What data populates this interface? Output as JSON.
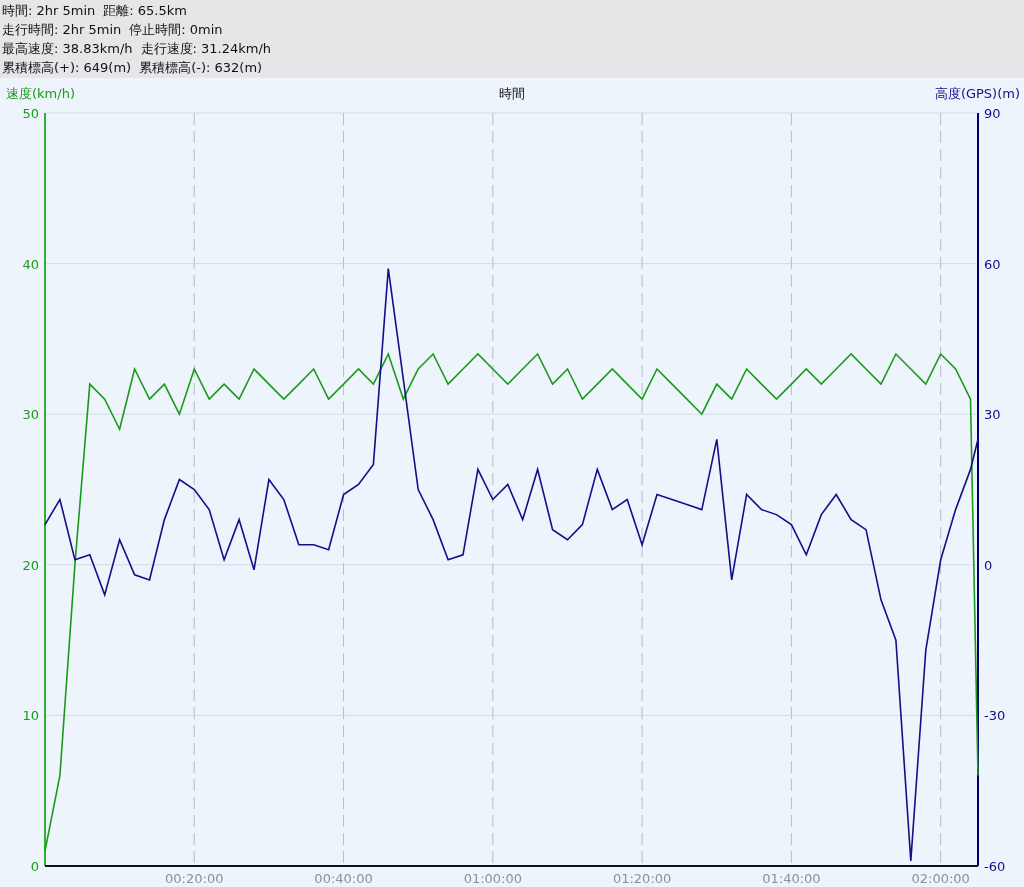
{
  "stats": [
    [
      "時間: 2hr 5min",
      "距離: 65.5km"
    ],
    [
      "走行時間: 2hr 5min",
      "停止時間: 0min"
    ],
    [
      "最高速度: 38.83km/h",
      "走行速度: 31.24km/h"
    ],
    [
      "累積標高(+): 649(m)",
      "累積標高(-): 632(m)"
    ]
  ],
  "chart_data": {
    "type": "line",
    "xlabel": "時間",
    "x": [
      0,
      2,
      4,
      6,
      8,
      10,
      12,
      14,
      16,
      18,
      20,
      22,
      24,
      26,
      28,
      30,
      32,
      34,
      36,
      38,
      40,
      42,
      44,
      46,
      48,
      50,
      52,
      54,
      56,
      58,
      60,
      62,
      64,
      66,
      68,
      70,
      72,
      74,
      76,
      78,
      80,
      82,
      84,
      86,
      88,
      90,
      92,
      94,
      96,
      98,
      100,
      102,
      104,
      106,
      108,
      110,
      112,
      114,
      116,
      118,
      120,
      122,
      124,
      125
    ],
    "xlim": [
      0,
      125
    ],
    "ylim": [
      0,
      50
    ],
    "y2lim": [
      -60,
      90
    ],
    "grid": true,
    "xticks": [
      {
        "value": 20,
        "label": "00:20:00"
      },
      {
        "value": 40,
        "label": "00:40:00"
      },
      {
        "value": 60,
        "label": "01:00:00"
      },
      {
        "value": 80,
        "label": "01:20:00"
      },
      {
        "value": 100,
        "label": "01:40:00"
      },
      {
        "value": 120,
        "label": "02:00:00"
      }
    ],
    "yticks": [
      0,
      10,
      20,
      30,
      40,
      50
    ],
    "y2ticks": [
      -60,
      -30,
      0,
      30,
      60,
      90
    ],
    "series": [
      {
        "name": "速度(km/h)",
        "color": "#1a9a1a",
        "axis": "y",
        "values": [
          1,
          6,
          20,
          32,
          31,
          29,
          33,
          31,
          32,
          30,
          33,
          31,
          32,
          31,
          33,
          32,
          31,
          32,
          33,
          31,
          32,
          33,
          32,
          34,
          31,
          33,
          34,
          32,
          33,
          34,
          33,
          32,
          33,
          34,
          32,
          33,
          31,
          32,
          33,
          32,
          31,
          33,
          32,
          31,
          30,
          32,
          31,
          33,
          32,
          31,
          32,
          33,
          32,
          33,
          34,
          33,
          32,
          34,
          33,
          32,
          34,
          33,
          31,
          6
        ]
      },
      {
        "name": "高度(GPS)(m)",
        "color": "#10108a",
        "axis": "y2",
        "values": [
          8,
          13,
          1,
          2,
          -6,
          5,
          -2,
          -3,
          9,
          17,
          15,
          11,
          1,
          9,
          -1,
          17,
          13,
          4,
          4,
          3,
          14,
          16,
          20,
          59,
          37,
          15,
          9,
          1,
          2,
          19,
          13,
          16,
          9,
          19,
          7,
          5,
          8,
          19,
          11,
          13,
          4,
          14,
          13,
          12,
          11,
          25,
          -3,
          14,
          11,
          10,
          8,
          2,
          10,
          14,
          9,
          7,
          -7,
          -15,
          -59,
          -17,
          1,
          11,
          19,
          25
        ]
      }
    ]
  }
}
